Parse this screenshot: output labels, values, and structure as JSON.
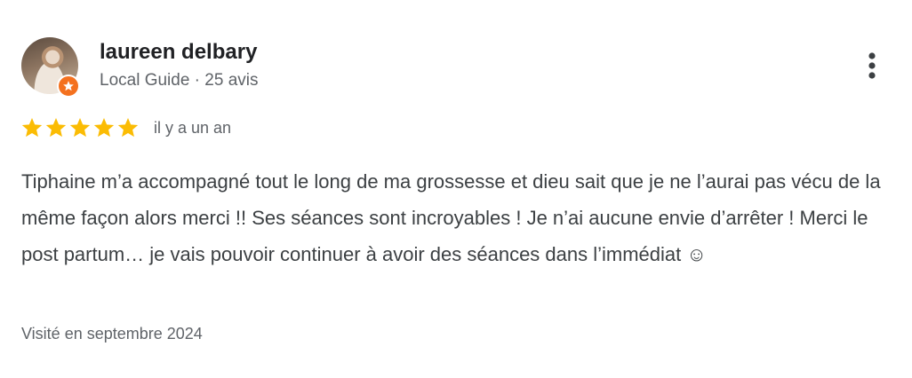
{
  "review": {
    "author_name": "laureen delbary",
    "author_meta": "Local Guide · 25 avis",
    "date": "il y a un an",
    "rating": 5,
    "text": "Tiphaine m’a accompagné tout le long de ma grossesse et dieu sait que je ne l’aurai pas vécu de la même façon alors merci !! Ses séances sont incroyables ! Je n’ai aucune envie d’arrêter ! Merci le post partum… je vais pouvoir continuer à avoir des séances dans l’immédiat ☺",
    "visited": "Visité en septembre 2024"
  },
  "colors": {
    "star": "#fbbc04",
    "guide_badge": "#f4711f",
    "name": "#202124",
    "secondary_text": "#5f6368",
    "body_text": "#3c4043"
  },
  "icons": {
    "avatar": "profile-photo",
    "badge": "local-guide-icon",
    "menu": "more-vertical-icon",
    "star": "star-icon"
  }
}
